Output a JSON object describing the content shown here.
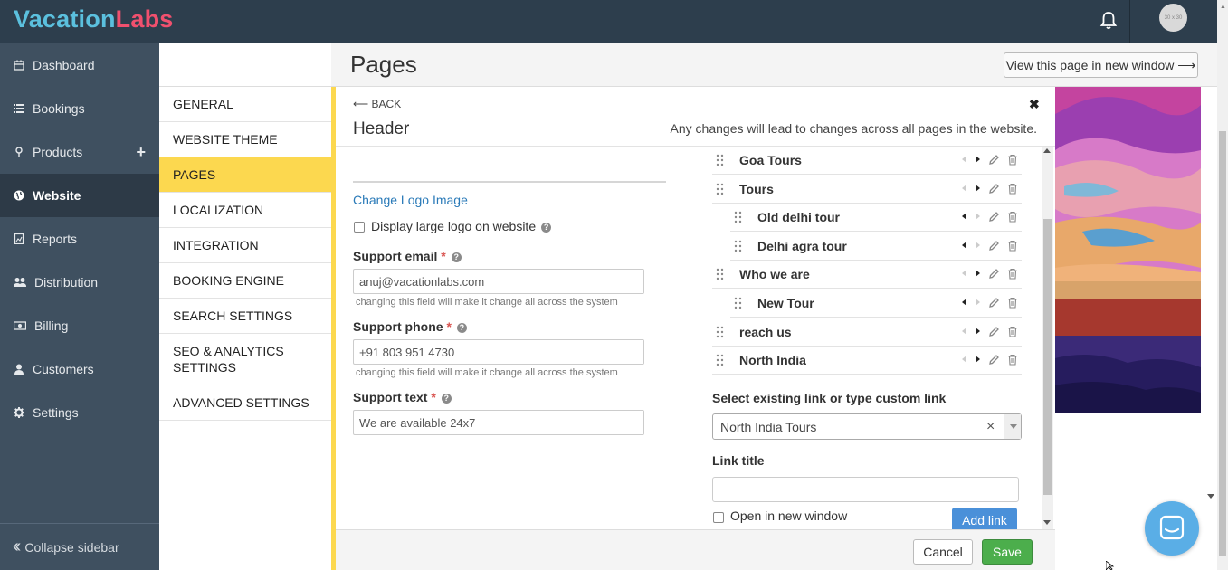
{
  "brand": {
    "part1": "Vacation",
    "part2": "Labs"
  },
  "topbar": {
    "avatar_text": "30 x 30"
  },
  "sidebar": {
    "items": [
      {
        "label": "Dashboard",
        "icon": "calendar-icon"
      },
      {
        "label": "Bookings",
        "icon": "list-icon"
      },
      {
        "label": "Products",
        "icon": "map-pin-icon"
      },
      {
        "label": "Website",
        "icon": "globe-icon"
      },
      {
        "label": "Reports",
        "icon": "report-icon"
      },
      {
        "label": "Distribution",
        "icon": "users-icon"
      },
      {
        "label": "Billing",
        "icon": "money-icon"
      },
      {
        "label": "Customers",
        "icon": "user-icon"
      },
      {
        "label": "Settings",
        "icon": "gear-icon"
      }
    ],
    "active": "Website",
    "collapse_label": "Collapse sidebar"
  },
  "submenu": {
    "items": [
      "GENERAL",
      "WEBSITE THEME",
      "PAGES",
      "LOCALIZATION",
      "INTEGRATION",
      "BOOKING ENGINE",
      "SEARCH SETTINGS",
      "SEO & ANALYTICS SETTINGS",
      "ADVANCED SETTINGS"
    ],
    "active": "PAGES"
  },
  "page": {
    "title": "Pages",
    "view_button": "View this page in new window ⟶"
  },
  "editor": {
    "back": "⟵ BACK",
    "title": "Header",
    "note": "Any changes will lead to changes across all pages in the website.",
    "change_logo": "Change Logo Image",
    "large_logo_label": "Display large logo on website",
    "fields": [
      {
        "label": "Support email",
        "value": "anuj@vacationlabs.com",
        "help": "changing this field will make it change all across the system"
      },
      {
        "label": "Support phone",
        "value": "+91 803 951 4730",
        "help": "changing this field will make it change all across the system"
      },
      {
        "label": "Support text",
        "value": "We are available 24x7",
        "help": ""
      }
    ],
    "menu_items": [
      {
        "label": "Goa Tours",
        "level": 0
      },
      {
        "label": "Tours",
        "level": 0
      },
      {
        "label": "Old delhi tour",
        "level": 1
      },
      {
        "label": "Delhi agra tour",
        "level": 1
      },
      {
        "label": "Who we are",
        "level": 0
      },
      {
        "label": "New Tour",
        "level": 1
      },
      {
        "label": "reach us",
        "level": 0
      },
      {
        "label": "North India",
        "level": 0
      }
    ],
    "select_label": "Select existing link or type custom link",
    "select_value": "North India Tours",
    "link_title_label": "Link title",
    "link_title_value": "",
    "open_new_window": "Open in new window",
    "add_link": "Add link",
    "cancel": "Cancel",
    "save": "Save"
  },
  "colors": {
    "accent": "#fcd84f",
    "topbar": "#2d3e4d",
    "sidebar": "#3f5060",
    "primary": "#4a90d9",
    "success": "#4cae4c",
    "link": "#2a7ab8"
  }
}
